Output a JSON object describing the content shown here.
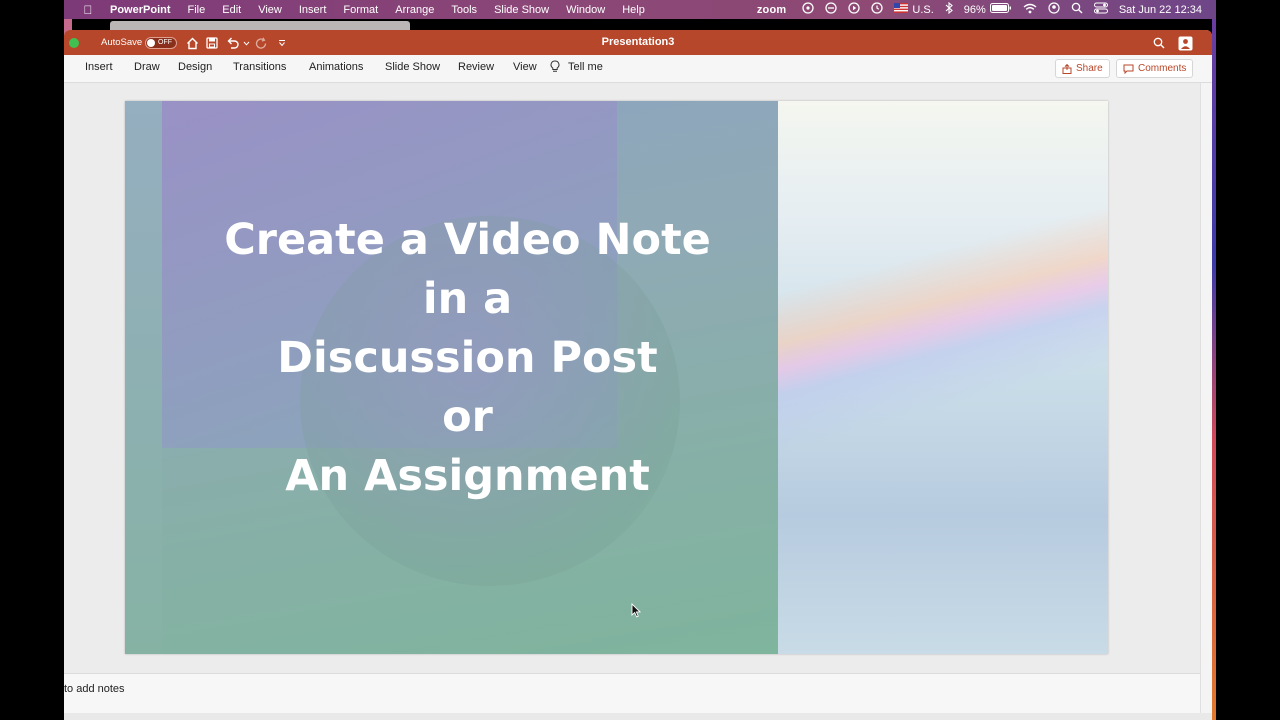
{
  "menubar": {
    "app_name": "PowerPoint",
    "menus": [
      "File",
      "Edit",
      "View",
      "Insert",
      "Format",
      "Arrange",
      "Tools",
      "Slide Show",
      "Window",
      "Help"
    ],
    "zoom_label": "zoom",
    "input_source": "U.S.",
    "battery": "96%",
    "datetime": "Sat Jun 22  12:34"
  },
  "titlebar": {
    "autosave_label": "AutoSave",
    "autosave_state": "OFF",
    "document_title": "Presentation3"
  },
  "ribbon": {
    "tabs": [
      "Insert",
      "Draw",
      "Design",
      "Transitions",
      "Animations",
      "Slide Show",
      "Review",
      "View"
    ],
    "tell_me": "Tell me",
    "share_label": "Share",
    "comments_label": "Comments"
  },
  "slide": {
    "title_lines": [
      "Create a Video Note",
      "in a",
      "Discussion Post",
      "or",
      "An Assignment"
    ]
  },
  "notes": {
    "placeholder": "to add notes"
  },
  "colors": {
    "accent": "#b7472a",
    "menubar": "#8a4677"
  }
}
